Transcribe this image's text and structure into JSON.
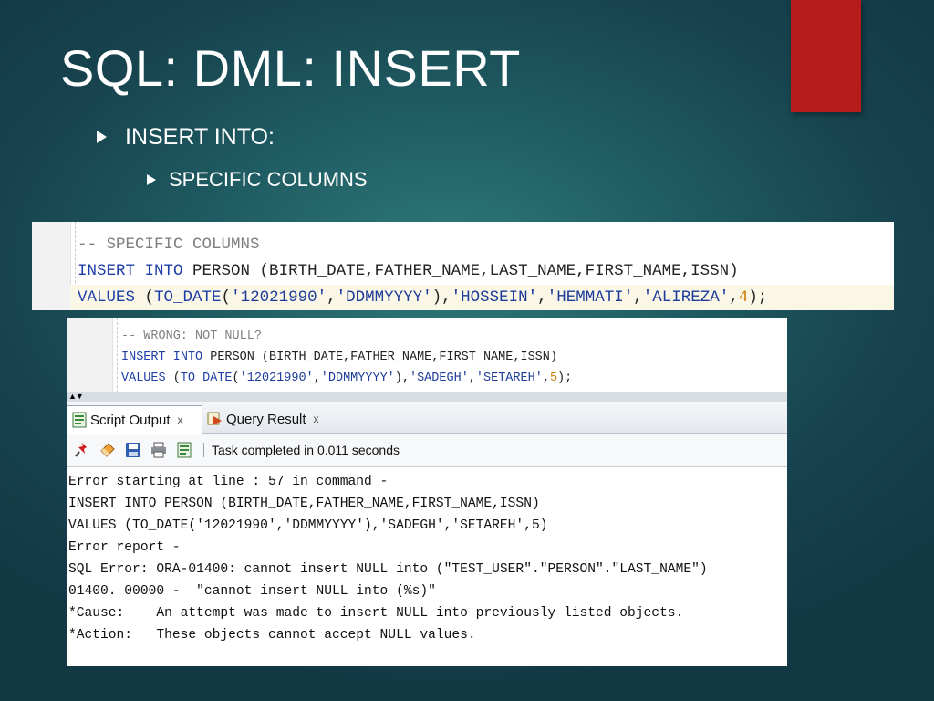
{
  "slide": {
    "title": "SQL: DML: INSERT",
    "bullet1": "INSERT INTO:",
    "bullet2": "SPECIFIC COLUMNS",
    "accent_color": "#b51c1c"
  },
  "code_block_1": {
    "line1": {
      "comment": "-- SPECIFIC COLUMNS"
    },
    "line2": {
      "kw1": "INSERT",
      "kw2": "INTO",
      "rest": " PERSON (BIRTH_DATE,FATHER_NAME,LAST_NAME,FIRST_NAME,ISSN)"
    },
    "line3": {
      "kw": "VALUES",
      "p1": " (",
      "func": "TO_DATE",
      "p2": "(",
      "s1": "'12021990'",
      "c1": ",",
      "s2": "'DDMMYYYY'",
      "p3": "),",
      "s3": "'HOSSEIN'",
      "c2": ",",
      "s4": "'HEMMATI'",
      "c3": ",",
      "s5": "'ALIREZA'",
      "c4": ",",
      "num": "4",
      "end": ");"
    }
  },
  "code_block_2": {
    "line1": {
      "comment": "-- WRONG: NOT NULL?"
    },
    "line2": {
      "kw1": "INSERT",
      "kw2": "INTO",
      "rest": " PERSON (BIRTH_DATE,FATHER_NAME,FIRST_NAME,ISSN)"
    },
    "line3": {
      "kw": "VALUES",
      "p1": " (",
      "func": "TO_DATE",
      "p2": "(",
      "s1": "'12021990'",
      "c1": ",",
      "s2": "'DDMMYYYY'",
      "p3": "),",
      "s3": "'SADEGH'",
      "c2": ",",
      "s4": "'SETAREH'",
      "c3": ",",
      "num": "5",
      "end": ");"
    }
  },
  "tabs": {
    "script_output": "Script Output",
    "query_result": "Query Result",
    "close_glyph": "x"
  },
  "toolbar": {
    "status": "Task completed in 0.011 seconds"
  },
  "output": {
    "lines": [
      "Error starting at line : 57 in command -",
      "INSERT INTO PERSON (BIRTH_DATE,FATHER_NAME,FIRST_NAME,ISSN)",
      "VALUES (TO_DATE('12021990','DDMMYYYY'),'SADEGH','SETAREH',5)",
      "Error report -",
      "SQL Error: ORA-01400: cannot insert NULL into (\"TEST_USER\".\"PERSON\".\"LAST_NAME\")",
      "01400. 00000 -  \"cannot insert NULL into (%s)\"",
      "*Cause:    An attempt was made to insert NULL into previously listed objects.",
      "*Action:   These objects cannot accept NULL values."
    ]
  }
}
